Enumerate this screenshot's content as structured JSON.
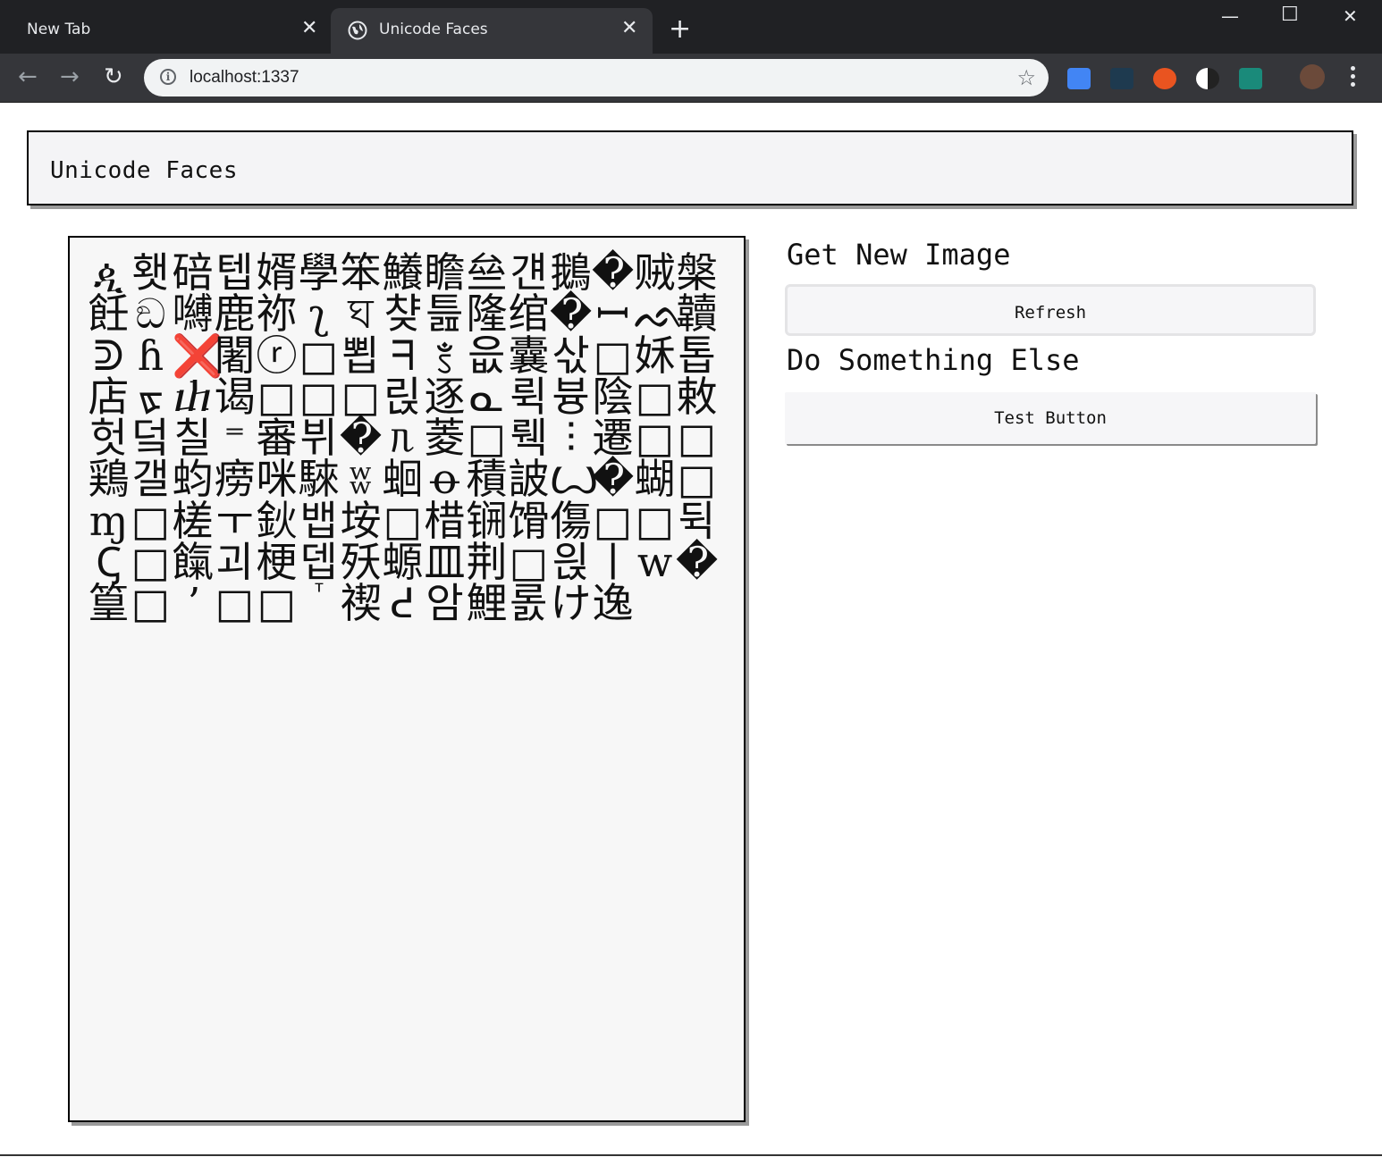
{
  "browser": {
    "tabs": [
      {
        "title": "New Tab",
        "active": false
      },
      {
        "title": "Unicode Faces",
        "active": true
      }
    ],
    "new_tab_icon": "plus-icon",
    "window_controls": [
      "minimize-icon",
      "maximize-icon",
      "close-icon"
    ],
    "address": "localhost:1337",
    "extensions": [
      "google-translate-icon",
      "password-dots-icon",
      "ubuntu-icon",
      "dark-reader-icon",
      "monitor-icon",
      "avatar-icon"
    ]
  },
  "page": {
    "header_title": "Unicode Faces",
    "image": {
      "glyphs": [
        "ዺ",
        "횃",
        "碚",
        "텝",
        "婿",
        "學",
        "笨",
        "鱶",
        "瞻",
        "亝",
        "걘",
        "鵝",
        "�",
        "贼",
        "槃",
        "飪",
        "ඞ",
        "嚩",
        "鹿",
        "祢",
        "ʅ",
        "ঘ",
        "챶",
        "틆",
        "隆",
        "绾",
        "�",
        "ꟷ",
        "ᨒ",
        "韥",
        "ᕲ",
        "ɦ",
        "❌",
        "闍",
        "ⓡ",
        "□",
        "뾥",
        "ᖷ",
        "ꣷ",
        "읎",
        "囊",
        "삯",
        "□",
        "姀",
        "톱",
        "店",
        "ᢘ",
        "ⴐ",
        "谒",
        "□",
        "□",
        "□",
        "릱",
        "逐",
        "ᓇ",
        "뤽",
        "븅",
        "陰",
        "□",
        "敕",
        "헛",
        "덬",
        "칠",
        "⁼",
        "審",
        "뷔",
        "�",
        "ᥰ",
        "菱",
        "□",
        "뤡",
        "⫶",
        "遷",
        "□",
        "□",
        "鶏",
        "갤",
        "蚐",
        "痨",
        "咪",
        "騋",
        "ʬ",
        "蛔",
        "ꝋ",
        "積",
        "詖",
        "Ꙍ",
        "�",
        "蝴",
        "□",
        "ɱ",
        "□",
        "槎",
        "ㅜ",
        "鈥",
        "뱁",
        "垵",
        "□",
        "棤",
        "锎",
        "馉",
        "傷",
        "□",
        "□",
        "뒥",
        "Ꞔ",
        "□",
        "餼",
        "괴",
        "梗",
        "뎁",
        "殀",
        "螈",
        "皿",
        "荆",
        "□",
        "읝",
        "ㅣ",
        "ᴡ",
        "�",
        "篁",
        "□",
        "ʼ",
        "□",
        "□",
        "ⷮ",
        "禊",
        "ᕍ",
        "암",
        "鯉",
        "롨",
        "け",
        "逸",
        "",
        ""
      ]
    },
    "actions": [
      {
        "heading": "Get New Image",
        "button_label": "Refresh"
      },
      {
        "heading": "Do Something Else",
        "button_label": "Test Button"
      }
    ]
  }
}
